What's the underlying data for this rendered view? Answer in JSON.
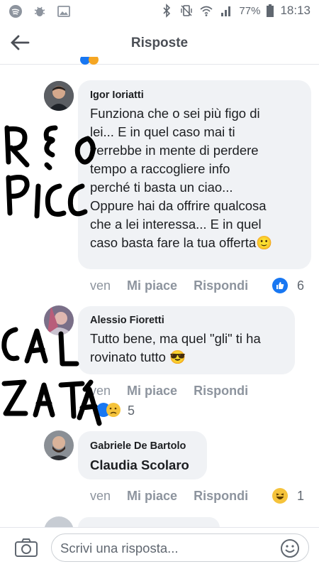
{
  "status_bar": {
    "battery": "77%",
    "time": "18:13"
  },
  "header": {
    "title": "Risposte"
  },
  "comments": [
    {
      "author": "Igor Ioriatti",
      "lines": [
        "Funziona che o sei più figo di",
        "lei... E in quel caso mai ti",
        "verrebbe in mente di perdere",
        "tempo a raccogliere info",
        "perché ti basta un ciao...",
        "Oppure hai da offrire qualcosa",
        "che a lei interessa... E in quel",
        "caso basta fare la tua offerta🙂"
      ],
      "time": "ven",
      "like_label": "Mi piace",
      "reply_label": "Rispondi",
      "reaction_count": "6"
    },
    {
      "author": "Alessio Fioretti",
      "lines": [
        "Tutto bene, ma quel \"gli\" ti ha",
        "rovinato tutto 😎"
      ],
      "time": "ven",
      "like_label": "Mi piace",
      "reply_label": "Rispondi",
      "reaction_count": "5"
    },
    {
      "author": "Gabriele De Bartolo",
      "lines": [
        "Claudia Scolaro"
      ],
      "time": "ven",
      "like_label": "Mi piace",
      "reply_label": "Rispondi",
      "reaction_count": "1"
    }
  ],
  "composer": {
    "placeholder": "Scrivi una risposta..."
  },
  "handwriting": [
    "REO",
    "PICC",
    "CAL",
    "ZATA"
  ],
  "colors": {
    "like_blue": "#1877f2",
    "bubble": "#f0f2f5",
    "muted": "#8d949e"
  }
}
